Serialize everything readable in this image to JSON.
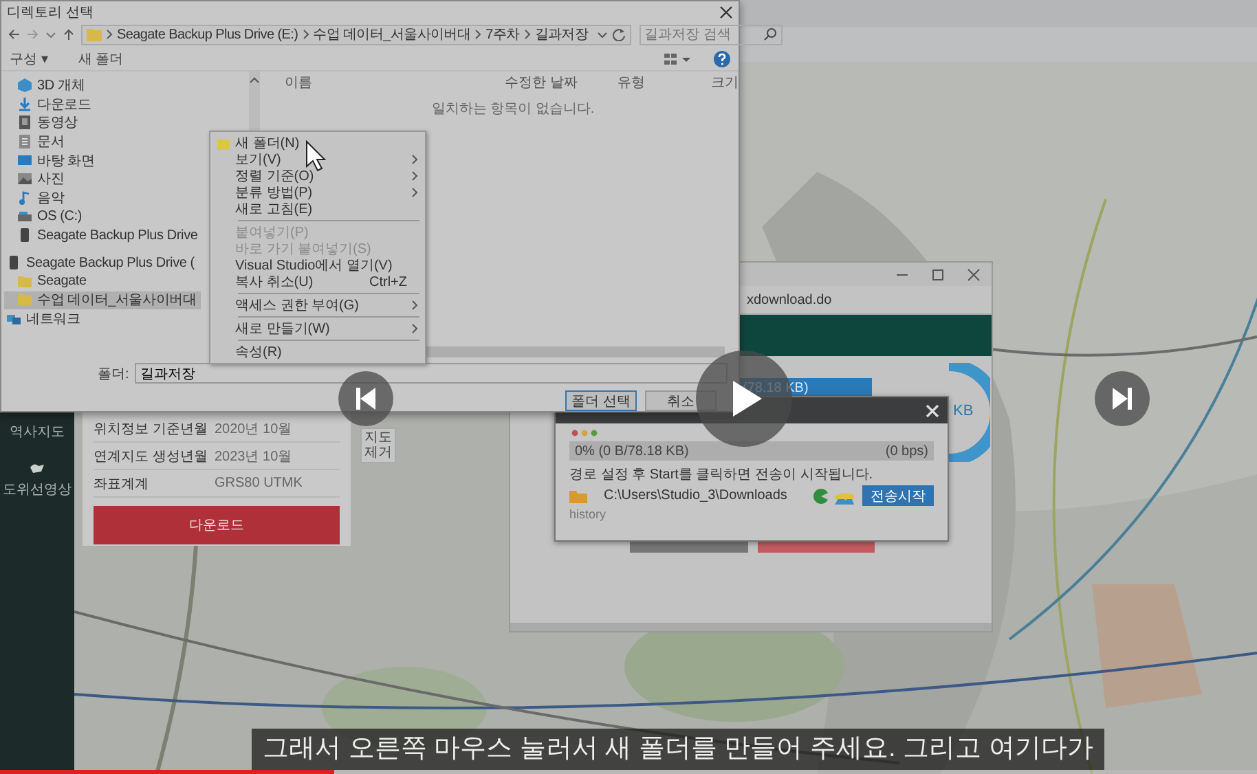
{
  "file_dialog": {
    "title": "디렉토리 선택",
    "breadcrumb": [
      "Seagate Backup Plus Drive (E:)",
      "수업 데이터_서울사이버대",
      "7주차",
      "길과저장"
    ],
    "search": {
      "placeholder": "길과저장 검색"
    },
    "toolbar": [
      "구성 ▾",
      "새 폴더"
    ],
    "nav_items": [
      {
        "label": "3D 개체",
        "selected": false
      },
      {
        "label": "다운로드",
        "selected": false
      },
      {
        "label": "동영상",
        "selected": false
      },
      {
        "label": "문서",
        "selected": false
      },
      {
        "label": "바탕 화면",
        "selected": false
      },
      {
        "label": "사진",
        "selected": false
      },
      {
        "label": "음악",
        "selected": false
      },
      {
        "label": "OS (C:)",
        "selected": false
      },
      {
        "label": "Seagate Backup Plus Drive",
        "selected": false
      },
      {
        "label": "Seagate Backup Plus Drive (",
        "selected": false,
        "children": [
          {
            "label": "Seagate",
            "selected": false
          },
          {
            "label": "수업 데이터_서울사이버대",
            "selected": true
          }
        ]
      },
      {
        "label": "네트워크",
        "selected": false
      }
    ],
    "columns": [
      "이름",
      "수정한 날짜",
      "유형",
      "크기"
    ],
    "empty_message": "일치하는 항목이 없습니다.",
    "folder_label": "폴더:",
    "folder_value": "길과저장",
    "buttons": [
      "폴더 선택",
      "취소"
    ]
  },
  "context_menu": {
    "items": [
      {
        "kind": "item",
        "label": "새 폴더(N)",
        "icon": true,
        "submenu": false,
        "disabled": false
      },
      {
        "kind": "item",
        "label": "보기(V)",
        "submenu": true,
        "disabled": false
      },
      {
        "kind": "item",
        "label": "정렬 기준(O)",
        "submenu": true,
        "disabled": false
      },
      {
        "kind": "item",
        "label": "분류 방법(P)",
        "submenu": true,
        "disabled": false
      },
      {
        "kind": "item",
        "label": "새로 고침(E)",
        "submenu": false,
        "disabled": false
      },
      {
        "kind": "separator"
      },
      {
        "kind": "item",
        "label": "붙여넣기(P)",
        "submenu": false,
        "disabled": true
      },
      {
        "kind": "item",
        "label": "바로 가기 붙여넣기(S)",
        "submenu": false,
        "disabled": true
      },
      {
        "kind": "item",
        "label": "Visual Studio에서 열기(V)",
        "submenu": false,
        "disabled": false
      },
      {
        "kind": "item",
        "label": "복사 취소(U)",
        "shortcut": "Ctrl+Z",
        "submenu": false,
        "disabled": false
      },
      {
        "kind": "separator"
      },
      {
        "kind": "item",
        "label": "액세스 권한 부여(G)",
        "submenu": true,
        "disabled": false
      },
      {
        "kind": "separator"
      },
      {
        "kind": "item",
        "label": "새로 만들기(W)",
        "submenu": true,
        "disabled": false
      },
      {
        "kind": "separator"
      },
      {
        "kind": "item",
        "label": "속성(R)",
        "submenu": false,
        "disabled": false
      }
    ]
  },
  "map_page": {
    "sidebar_items": [
      "역사지도",
      "도위선영상"
    ],
    "info_rows": [
      {
        "label": "위치정보 기준년월",
        "value": "2020년 10월"
      },
      {
        "label": "연계지도 생성년월",
        "value": "2023년 10월"
      },
      {
        "label": "좌표계계",
        "value": "GRS80 UTMK"
      }
    ],
    "download_button": "다운로드",
    "map_control": "지도 제거"
  },
  "browser_window": {
    "url": "xdownload.do",
    "size_label": "(78.18 KB)",
    "donut_text": "KB"
  },
  "download_dialog": {
    "progress_text": "0% (0 B/78.18 KB)",
    "speed": "(0 bps)",
    "level": 0,
    "message": "경로 설정 후 Start를 클릭하면 전송이 시작됩니다.",
    "path": "C:\\Users\\Studio_3\\Downloads",
    "start_button": "전송시작",
    "history": "history"
  },
  "player": {
    "caption": "그래서 오른쪽 마우스 눌러서 새 폴더를 만들어 주세요. 그리고 여기다가",
    "level": 0.266
  }
}
